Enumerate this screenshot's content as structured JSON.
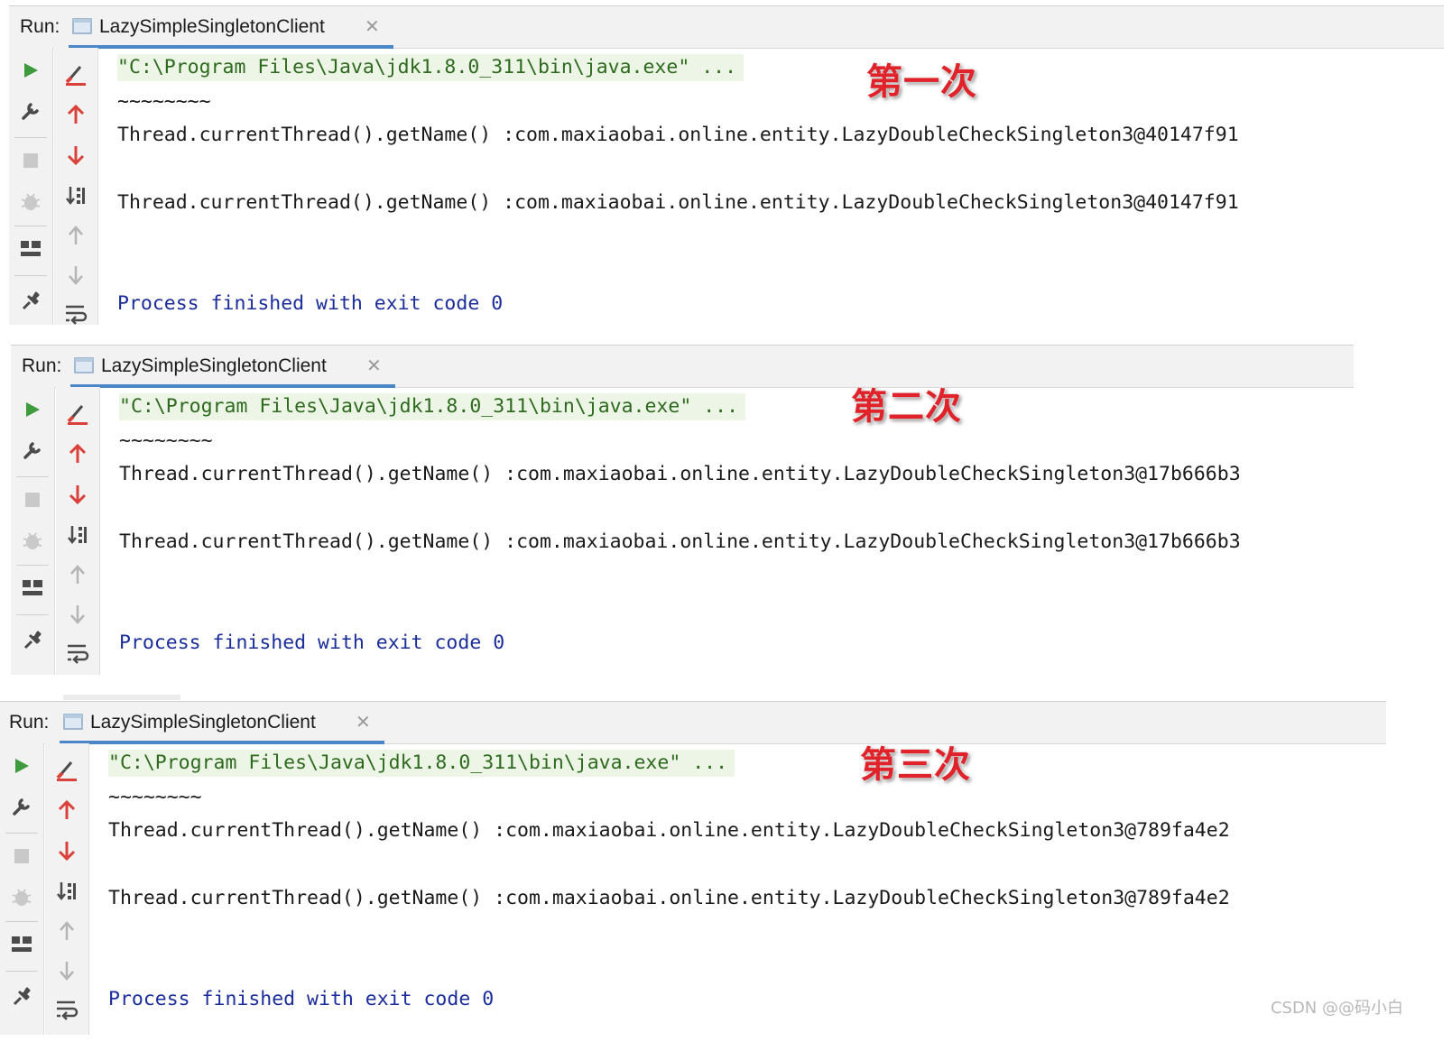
{
  "runs": [
    {
      "run_label": "Run:",
      "tab_title": "LazySimpleSingletonClient",
      "command": "\"C:\\Program Files\\Java\\jdk1.8.0_311\\bin\\java.exe\" ...",
      "tilde": "~~~~~~~~",
      "output1": "Thread.currentThread().getName() :com.maxiaobai.online.entity.LazyDoubleCheckSingleton3@40147f91",
      "output2": "Thread.currentThread().getName() :com.maxiaobai.online.entity.LazyDoubleCheckSingleton3@40147f91",
      "finished": "Process finished with exit code 0",
      "annotation": "第一次"
    },
    {
      "run_label": "Run:",
      "tab_title": "LazySimpleSingletonClient",
      "command": "\"C:\\Program Files\\Java\\jdk1.8.0_311\\bin\\java.exe\" ...",
      "tilde": "~~~~~~~~",
      "output1": "Thread.currentThread().getName() :com.maxiaobai.online.entity.LazyDoubleCheckSingleton3@17b666b3",
      "output2": "Thread.currentThread().getName() :com.maxiaobai.online.entity.LazyDoubleCheckSingleton3@17b666b3",
      "finished": "Process finished with exit code 0",
      "annotation": "第二次"
    },
    {
      "run_label": "Run:",
      "tab_title": "LazySimpleSingletonClient",
      "command": "\"C:\\Program Files\\Java\\jdk1.8.0_311\\bin\\java.exe\" ...",
      "tilde": "~~~~~~~~",
      "output1": "Thread.currentThread().getName() :com.maxiaobai.online.entity.LazyDoubleCheckSingleton3@789fa4e2",
      "output2": "Thread.currentThread().getName() :com.maxiaobai.online.entity.LazyDoubleCheckSingleton3@789fa4e2",
      "finished": "Process finished with exit code 0",
      "annotation": "第三次"
    }
  ],
  "watermark": "CSDN @@码小白",
  "colors": {
    "rerun_green": "#3d9a3d",
    "arrow_red": "#d9413a",
    "tab_accent": "#4a86c8",
    "annotation_red": "#e0232a",
    "finished_blue": "#1b2d9a"
  },
  "icons": {
    "col1": [
      "rerun-icon",
      "wrench-icon",
      "stop-icon",
      "debug-icon",
      "layout-icon",
      "pin-icon"
    ],
    "col2": [
      "clear-icon",
      "up-red-icon",
      "down-red-icon",
      "sort-icon",
      "up-grey-icon",
      "down-grey-icon",
      "softwrap-icon"
    ]
  }
}
